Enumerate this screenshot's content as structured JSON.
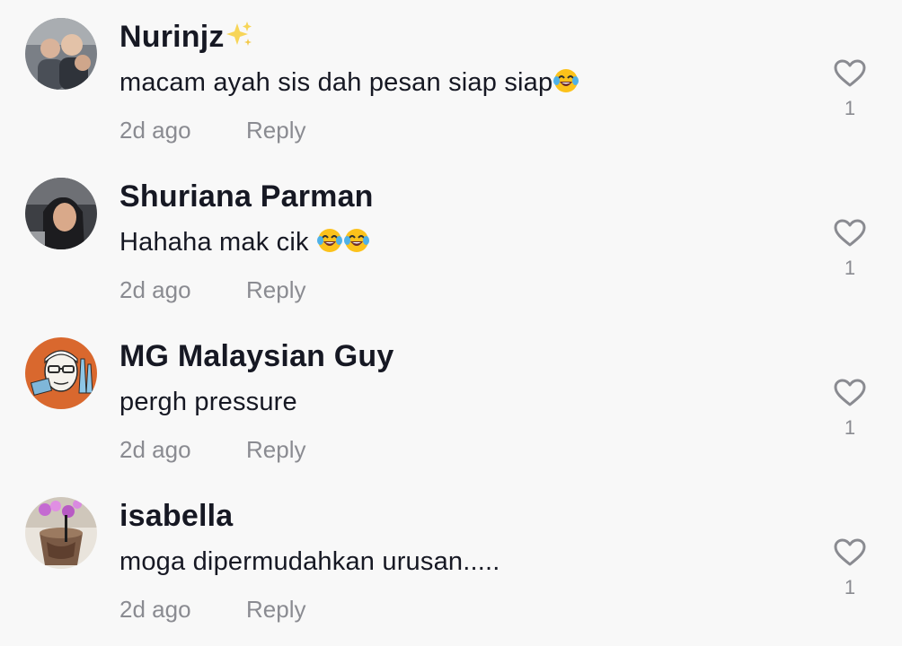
{
  "comments": [
    {
      "username": "Nurinjz",
      "username_suffix_icon": "sparkles-icon",
      "text": "macam ayah sis dah pesan siap siap",
      "text_emojis": [
        "face-with-tears-of-joy-icon"
      ],
      "time": "2d ago",
      "reply_label": "Reply",
      "like_count": "1"
    },
    {
      "username": "Shuriana Parman",
      "text": "Hahaha mak cik ",
      "text_emojis": [
        "face-with-tears-of-joy-icon",
        "face-with-tears-of-joy-icon"
      ],
      "time": "2d ago",
      "reply_label": "Reply",
      "like_count": "1"
    },
    {
      "username": "MG Malaysian Guy",
      "text": "pergh pressure",
      "time": "2d ago",
      "reply_label": "Reply",
      "like_count": "1"
    },
    {
      "username": "isabella",
      "text": "moga dipermudahkan urusan.....",
      "time": "2d ago",
      "reply_label": "Reply",
      "like_count": "1"
    }
  ],
  "colors": {
    "background": "#f8f8f8",
    "username": "#161823",
    "text": "#161823",
    "meta": "#8a8b91"
  }
}
